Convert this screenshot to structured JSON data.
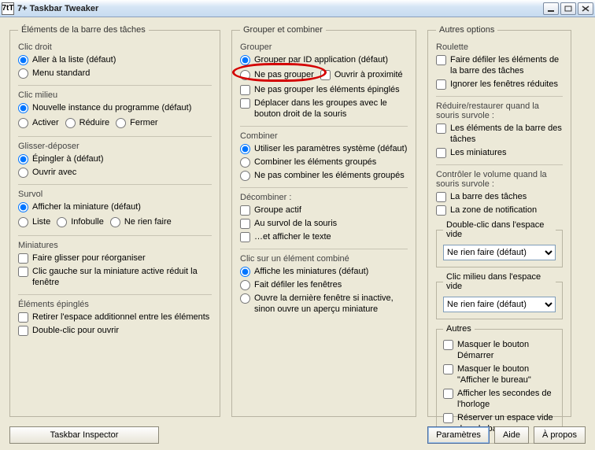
{
  "window": {
    "title": "7+ Taskbar Tweaker",
    "appicon": "7tT"
  },
  "columns": {
    "left": {
      "legend": "Éléments de la barre des tâches",
      "rightClick": {
        "label": "Clic droit",
        "options": [
          "Aller à la liste (défaut)",
          "Menu standard"
        ]
      },
      "middleClick": {
        "label": "Clic milieu",
        "options": [
          "Nouvelle instance du programme (défaut)",
          "Activer",
          "Réduire",
          "Fermer"
        ]
      },
      "dragDrop": {
        "label": "Glisser-déposer",
        "options": [
          "Épingler à (défaut)",
          "Ouvrir avec"
        ]
      },
      "hover": {
        "label": "Survol",
        "options": [
          "Afficher la miniature (défaut)",
          "Liste",
          "Infobulle",
          "Ne rien faire"
        ]
      },
      "thumbnails": {
        "label": "Miniatures",
        "options": [
          "Faire glisser pour réorganiser",
          "Clic gauche sur la miniature active réduit la fenêtre"
        ]
      },
      "pinned": {
        "label": "Éléments épinglés",
        "options": [
          "Retirer l'espace additionnel entre les éléments",
          "Double-clic pour ouvrir"
        ]
      }
    },
    "middle": {
      "legend": "Grouper et combiner",
      "group": {
        "label": "Grouper",
        "r1": "Grouper par ID application (défaut)",
        "r2": "Ne pas grouper",
        "c2": "Ouvrir à proximité",
        "c3": "Ne pas grouper les éléments épinglés",
        "c4": "Déplacer dans les groupes avec le bouton droit de la souris"
      },
      "combine": {
        "label": "Combiner",
        "options": [
          "Utiliser les paramètres système (défaut)",
          "Combiner les éléments groupés",
          "Ne pas combiner les éléments groupés"
        ]
      },
      "decombine": {
        "label": "Décombiner :",
        "c1": "Groupe actif",
        "c2": "Au survol de la souris",
        "c2b": "…et afficher le texte"
      },
      "combinedClick": {
        "label": "Clic sur un élément combiné",
        "options": [
          "Affiche les miniatures (défaut)",
          "Fait défiler les fenêtres",
          "Ouvre la dernière fenêtre si inactive, sinon ouvre un aperçu miniature"
        ]
      }
    },
    "right": {
      "legend": "Autres options",
      "wheel": {
        "label": "Roulette",
        "c1": "Faire défiler les éléments de la barre des tâches",
        "c1b": "Ignorer les fenêtres réduites"
      },
      "minHover": {
        "label": "Réduire/restaurer quand la souris survole :",
        "c1": "Les éléments de la barre des tâches",
        "c2": "Les miniatures"
      },
      "volHover": {
        "label": "Contrôler le volume quand la souris survole :",
        "c1": "La barre des tâches",
        "c2": "La zone de notification"
      },
      "dblClick": {
        "legend": "Double-clic dans l'espace vide",
        "value": "Ne rien faire (défaut)"
      },
      "midClick": {
        "legend": "Clic milieu dans l'espace vide",
        "value": "Ne rien faire (défaut)"
      },
      "others": {
        "legend": "Autres",
        "c1": "Masquer le bouton Démarrer",
        "c2": "Masquer le bouton \"Afficher le bureau\"",
        "c3": "Afficher les secondes de l'horloge",
        "c4": "Réserver un espace vide dans la barre"
      }
    }
  },
  "buttons": {
    "inspector": "Taskbar Inspector",
    "params": "Paramètres",
    "help": "Aide",
    "about": "À propos"
  }
}
